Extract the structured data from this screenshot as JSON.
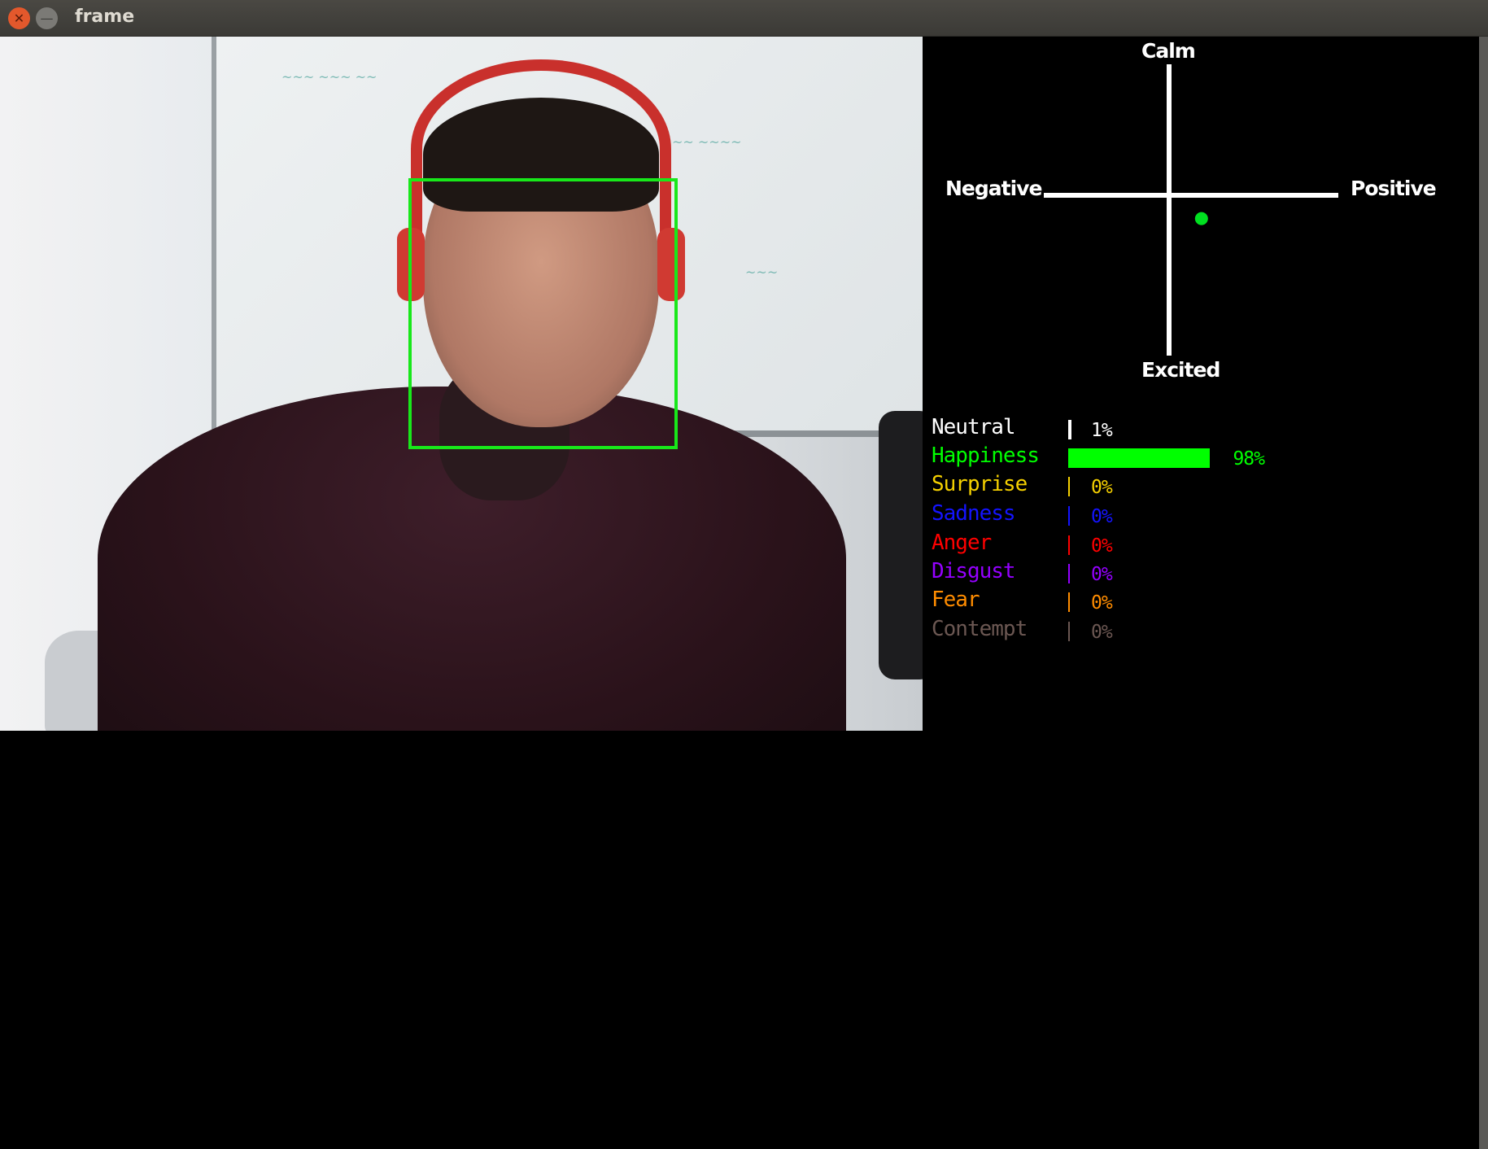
{
  "window": {
    "title": "frame",
    "close_icon": "close-icon",
    "minimize_icon": "minimize-icon"
  },
  "colors": {
    "face_box": "#18e81a",
    "axes": "#ffffff",
    "point": "#00e020"
  },
  "circumplex": {
    "top_label": "Calm",
    "bottom_label": "Excited",
    "left_label": "Negative",
    "right_label": "Positive",
    "point": {
      "valence": 0.22,
      "arousal": -0.16
    }
  },
  "emotions": [
    {
      "label": "Neutral",
      "percent": 1,
      "text": "1%",
      "color": "#ffffff"
    },
    {
      "label": "Happiness",
      "percent": 98,
      "text": "98%",
      "color": "#00ff00"
    },
    {
      "label": "Surprise",
      "percent": 0,
      "text": "0%",
      "color": "#f5d000"
    },
    {
      "label": "Sadness",
      "percent": 0,
      "text": "0%",
      "color": "#1414ff"
    },
    {
      "label": "Anger",
      "percent": 0,
      "text": "0%",
      "color": "#ff0000"
    },
    {
      "label": "Disgust",
      "percent": 0,
      "text": "0%",
      "color": "#9400ff"
    },
    {
      "label": "Fear",
      "percent": 0,
      "text": "0%",
      "color": "#ff8c00"
    },
    {
      "label": "Contempt",
      "percent": 0,
      "text": "0%",
      "color": "#6b5752"
    }
  ]
}
